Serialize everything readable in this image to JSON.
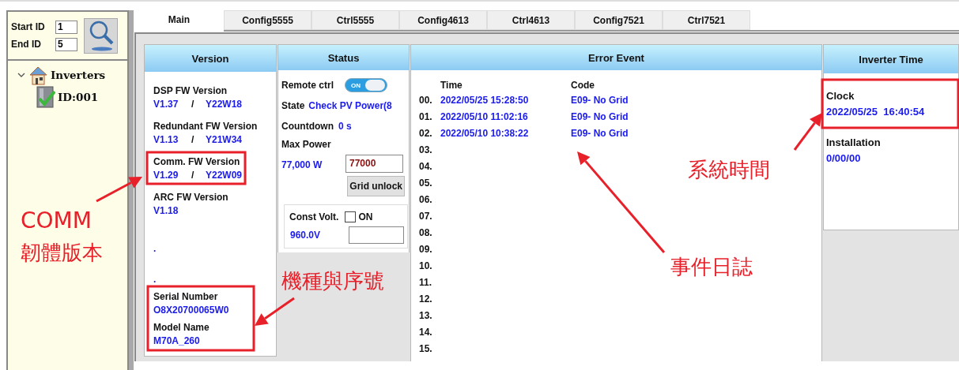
{
  "sidebar": {
    "search": {
      "start_label": "Start ID",
      "start_value": "1",
      "end_label": "End ID",
      "end_value": "5"
    },
    "tree": [
      {
        "label": "Inverters",
        "expanded": true,
        "children": [
          {
            "label": "ID:001"
          }
        ]
      }
    ]
  },
  "tabs": [
    {
      "label": "Main",
      "selected": true
    },
    {
      "label": "Config5555",
      "selected": false
    },
    {
      "label": "Ctrl5555",
      "selected": false
    },
    {
      "label": "Config4613",
      "selected": false
    },
    {
      "label": "Ctrl4613",
      "selected": false
    },
    {
      "label": "Config7521",
      "selected": false
    },
    {
      "label": "Ctrl7521",
      "selected": false
    }
  ],
  "version_panel": {
    "title": "Version",
    "items": [
      {
        "label": "DSP FW Version",
        "version": "V1.37",
        "separator": "/",
        "build": "Y22W18"
      },
      {
        "label": "Redundant FW Version",
        "version": "V1.13",
        "separator": "/",
        "build": "Y21W34"
      },
      {
        "label": "Comm. FW Version",
        "version": "V1.29",
        "separator": "/",
        "build": "Y22W09"
      },
      {
        "label": "ARC FW Version",
        "version": "V1.18"
      }
    ],
    "blank_values": [
      ".",
      "."
    ],
    "serial_label": "Serial Number",
    "serial": "O8X20700065W0",
    "model_label": "Model Name",
    "model": "M70A_260"
  },
  "status_panel": {
    "title": "Status",
    "remote_ctrl": {
      "label": "Remote ctrl",
      "toggle_text": "ON",
      "on": true
    },
    "state": {
      "label": "State",
      "value": "Check PV Power(8"
    },
    "countdown": {
      "label": "Countdown",
      "value": "0 s"
    },
    "max_power": {
      "label": "Max Power",
      "reading": "77,000 W",
      "input_value": "77000"
    },
    "grid_unlock": "Grid unlock",
    "const_volt": {
      "label": "Const Volt.",
      "checkbox_label": "ON",
      "checked": false,
      "reading": "960.0V"
    }
  },
  "error_panel": {
    "title": "Error Event",
    "columns": [
      "Time",
      "Code"
    ],
    "rows": [
      {
        "index": "00.",
        "time": "2022/05/25 15:28:50",
        "code": "E09- No Grid"
      },
      {
        "index": "01.",
        "time": "2022/05/10 11:02:16",
        "code": "E09- No Grid"
      },
      {
        "index": "02.",
        "time": "2022/05/10 10:38:22",
        "code": "E09- No Grid"
      },
      {
        "index": "03."
      },
      {
        "index": "04."
      },
      {
        "index": "05."
      },
      {
        "index": "06."
      },
      {
        "index": "07."
      },
      {
        "index": "08."
      },
      {
        "index": "09."
      },
      {
        "index": "10."
      },
      {
        "index": "11."
      },
      {
        "index": "12."
      },
      {
        "index": "13."
      },
      {
        "index": "14."
      },
      {
        "index": "15."
      }
    ]
  },
  "time_panel": {
    "title": "Inverter Time",
    "clock_label": "Clock",
    "clock": "2022/05/25  16:40:54",
    "installation_label": "Installation",
    "installation": "0/00/00"
  },
  "annotations": [
    {
      "lines": [
        "COMM",
        "韌體版本"
      ]
    },
    {
      "lines": [
        "機種與序號"
      ]
    },
    {
      "lines": [
        "系統時間"
      ]
    },
    {
      "lines": [
        "事件日誌"
      ]
    }
  ]
}
